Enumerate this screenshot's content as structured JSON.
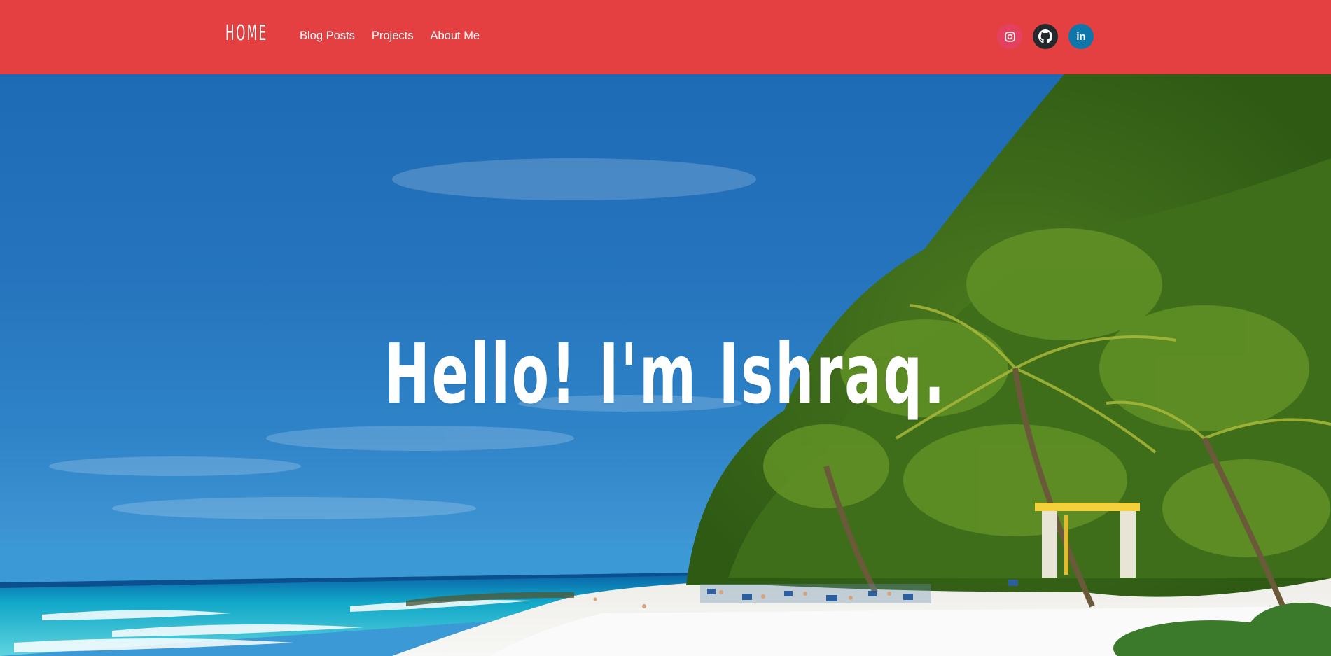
{
  "navbar": {
    "brand": "HOME",
    "links": [
      "Blog Posts",
      "Projects",
      "About Me"
    ],
    "background": "#e44042"
  },
  "socials": [
    {
      "name": "instagram",
      "icon": "instagram-icon",
      "color": "#e4405f"
    },
    {
      "name": "github",
      "icon": "github-icon",
      "color": "#24292e"
    },
    {
      "name": "linkedin",
      "icon": "linkedin-icon",
      "label": "in",
      "color": "#0e76a8"
    }
  ],
  "hero": {
    "title": "Hello! I'm Ishraq.",
    "background_scene": "tropical beach with palm trees and blue sky"
  }
}
